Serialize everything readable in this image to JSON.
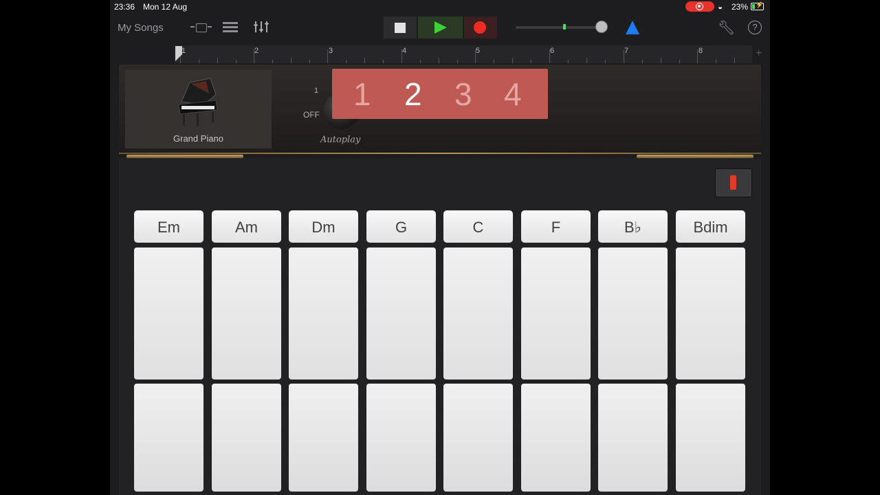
{
  "status": {
    "time": "23:36",
    "date": "Mon 12 Aug",
    "battery": "23%"
  },
  "toolbar": {
    "my_songs": "My Songs"
  },
  "ruler": {
    "marks": [
      "1",
      "2",
      "3",
      "4",
      "5",
      "6",
      "7",
      "8"
    ]
  },
  "instrument": {
    "name": "Grand Piano"
  },
  "autoplay": {
    "label": "Autoplay",
    "knob_one": "1",
    "knob_off": "OFF",
    "numbers": [
      "1",
      "2",
      "3",
      "4"
    ],
    "selected": "2"
  },
  "chords": [
    "Em",
    "Am",
    "Dm",
    "G",
    "C",
    "F",
    "B♭",
    "Bdim"
  ],
  "colors": {
    "accent_red": "#bf5954",
    "play_green": "#3fd13a",
    "record_red": "#f02b23",
    "metronome_blue": "#1e7bf2"
  }
}
